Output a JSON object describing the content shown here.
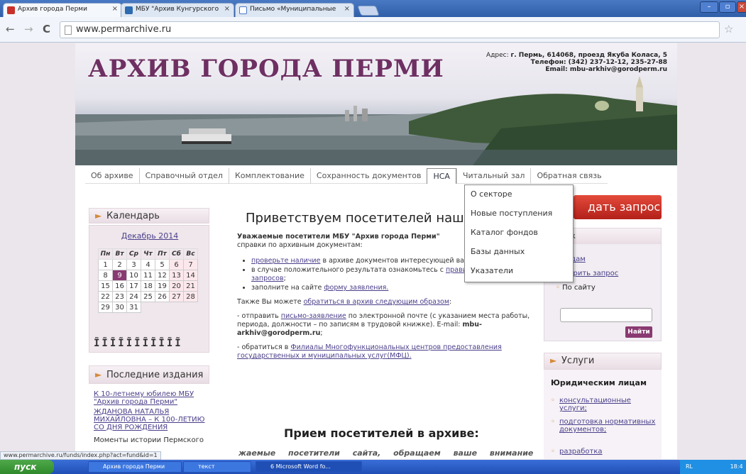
{
  "browser": {
    "tabs": [
      {
        "title": "Архив города Перми",
        "close": "×"
      },
      {
        "title": "МБУ \"Архив Кунгурского",
        "close": "×"
      },
      {
        "title": "Письмо «Муниципальные",
        "close": "×"
      }
    ],
    "url": "www.permarchive.ru",
    "status_url": "www.permarchive.ru/funds/index.php?act=fund&id=1"
  },
  "header": {
    "logo": "АРХИВ ГОРОДА ПЕРМИ",
    "address_line1_label": "Адрес:",
    "address_line1": "г. Пермь, 614068, проезд Якуба Коласа, 5",
    "address_line2": "Телефон: (342) 237-12-12, 235-27-88",
    "address_line3": "Email: mbu-arkhiv@gorodperm.ru"
  },
  "menu": {
    "items": [
      "Об архиве",
      "Справочный отдел",
      "Комплектование",
      "Сохранность документов",
      "НСА",
      "Читальный зал",
      "Обратная связь"
    ],
    "dropdown": [
      "О секторе",
      "Новые поступления",
      "Каталог фондов",
      "Базы данных",
      "Указатели"
    ]
  },
  "calendar": {
    "heading": "Календарь",
    "month": "Декабрь 2014",
    "weekdays": [
      "Пн",
      "Вт",
      "Ср",
      "Чт",
      "Пт",
      "Сб",
      "Вс"
    ],
    "weeks": [
      [
        "1",
        "2",
        "3",
        "4",
        "5",
        "6",
        "7"
      ],
      [
        "8",
        "9",
        "10",
        "11",
        "12",
        "13",
        "14"
      ],
      [
        "15",
        "16",
        "17",
        "18",
        "19",
        "20",
        "21"
      ],
      [
        "22",
        "23",
        "24",
        "25",
        "26",
        "27",
        "28"
      ],
      [
        "29",
        "30",
        "31",
        "",
        "",
        "",
        ""
      ]
    ],
    "today": "9"
  },
  "publications": {
    "heading": "Последние издания",
    "items": [
      "К 10-летнему юбилею МБУ \"Архив города Перми\"",
      "ЖДАНОВА НАТАЛЬЯ МИХАЙЛОВНА – К 100-ЛЕТИЮ СО ДНЯ РОЖДЕНИЯ",
      "Моменты истории Пермского"
    ]
  },
  "main": {
    "welcome": "Приветствуем посетителей наше",
    "intro_bold": "Уважаемые посетители МБУ \"Архив города Перми\"",
    "intro_rest": "справки по архивным документам:",
    "bullet1_link": "проверьте наличие",
    "bullet1_rest": " в архиве документов интересующей вас организации;",
    "bullet2_text": "в случае положительного результата ознакомьтесь с ",
    "bullet2_link": "правилами исполнения запросов",
    "bullet2_end": ";",
    "bullet3_text": "заполните на сайте ",
    "bullet3_link": "форму заявления.",
    "also_text": "Также Вы можете ",
    "also_link": "обратиться в архив следующим образом",
    "also_end": ":",
    "p1_a": "- отправить ",
    "p1_link": "письмо-заявление",
    "p1_b": " по электронной почте (с указанием места работы, периода, должности – по записям в трудовой книжке). E-mail: ",
    "p1_email": "mbu-arkhiv@gorodperm.ru",
    "p1_end": ";",
    "p2_a": "- обратиться в ",
    "p2_link": "Филиалы Многофункциональных центров предоставления государственных и муниципальных услуг(МФЦ).",
    "h2": "Прием посетителей в архиве:",
    "italic": "жаемые посетители сайта, обращаем ваше внимание"
  },
  "right": {
    "request_button": "дать запрос",
    "search_heading": "иск",
    "search_opt1": "фондам",
    "search_opt2": "роверить запрос",
    "search_opt3": "По сайту",
    "search_button": "Найти",
    "services_heading": "Услуги",
    "services_sub": "Юридическим лицам",
    "services": [
      "консультационные услуги;",
      "подготовка нормативных документов;",
      "разработка"
    ]
  },
  "taskbar": {
    "start": "пуск",
    "items": [
      "Архив города Перми",
      "текст",
      "6 Microsoft Word fo..."
    ],
    "tray_lang": "RL",
    "clock": "18:4"
  },
  "colors": {
    "accent": "#8a3a72",
    "link": "#4a3f8a",
    "request": "#c92f22"
  }
}
